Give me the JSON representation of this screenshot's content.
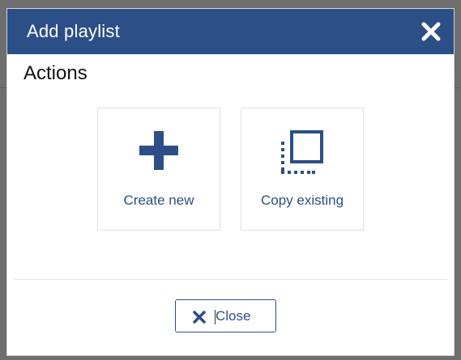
{
  "colors": {
    "header_bg": "#2b4f86",
    "accent": "#2b4f86",
    "overlay": "#6e6e6e"
  },
  "modal": {
    "title": "Add playlist",
    "close_icon": "close-icon",
    "section_title": "Actions",
    "actions": [
      {
        "label": "Create new",
        "icon": "plus-icon"
      },
      {
        "label": "Copy existing",
        "icon": "copy-icon"
      }
    ],
    "footer": {
      "close_label": "Close",
      "close_icon": "close-icon"
    }
  }
}
